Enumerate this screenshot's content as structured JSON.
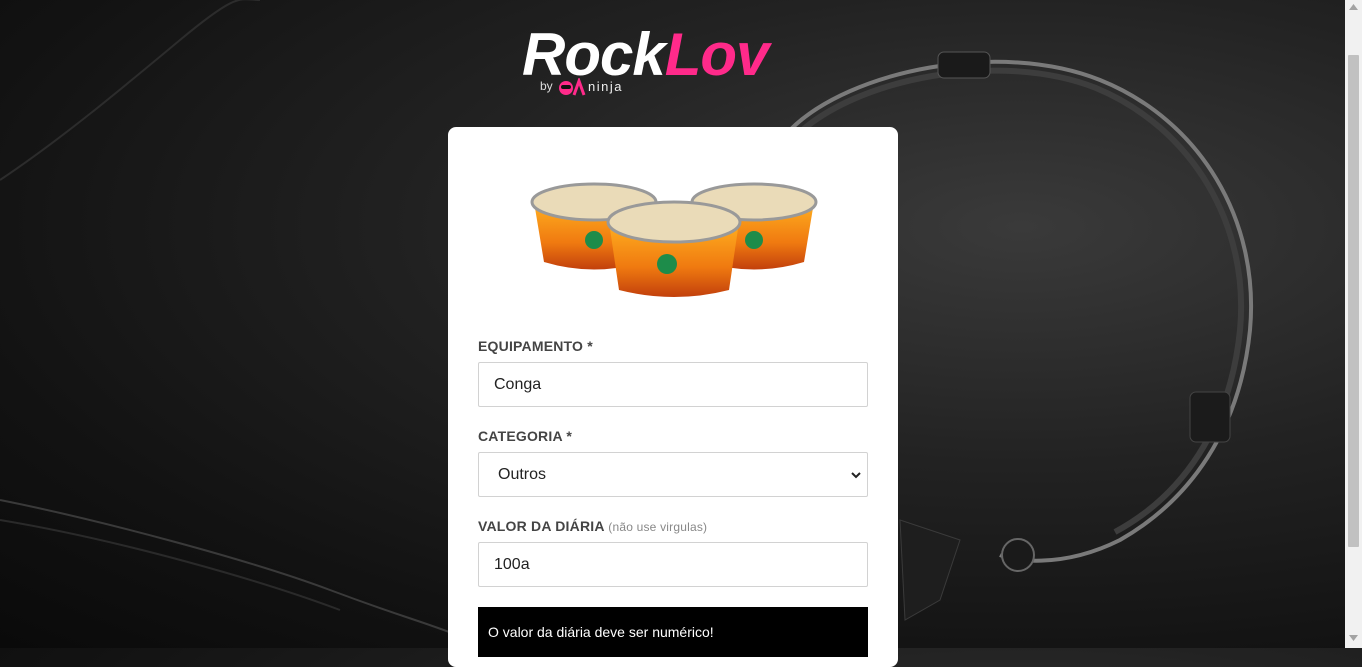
{
  "brand": {
    "rock": "Rock",
    "lov": "Lov",
    "by": "by",
    "qa": "QA",
    "ninja": "ninja",
    "accent_color": "#ff2a8a"
  },
  "product_image": {
    "icon": "bongo-drums-image"
  },
  "form": {
    "equipment": {
      "label": "EQUIPAMENTO *",
      "value": "Conga"
    },
    "category": {
      "label": "CATEGORIA *",
      "selected": "Outros"
    },
    "daily_price": {
      "label": "VALOR DA DIÁRIA",
      "hint": "(não use virgulas)",
      "value": "100a"
    },
    "error": "O valor da diária deve ser numérico!"
  }
}
